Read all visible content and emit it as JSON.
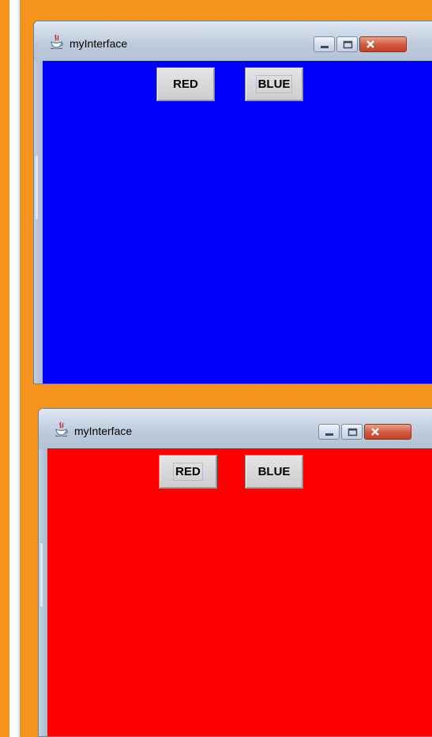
{
  "windows": [
    {
      "title": "myInterface",
      "background_color": "#0000ff",
      "buttons": {
        "red_label": "RED",
        "blue_label": "BLUE"
      },
      "focused_button": "BLUE"
    },
    {
      "title": "myInterface",
      "background_color": "#ff0000",
      "buttons": {
        "red_label": "RED",
        "blue_label": "BLUE"
      },
      "focused_button": "RED"
    }
  ],
  "window_controls": [
    "minimize-icon",
    "maximize-icon",
    "close-icon"
  ],
  "app_icon": "java-icon",
  "page_background": "#f7941d"
}
